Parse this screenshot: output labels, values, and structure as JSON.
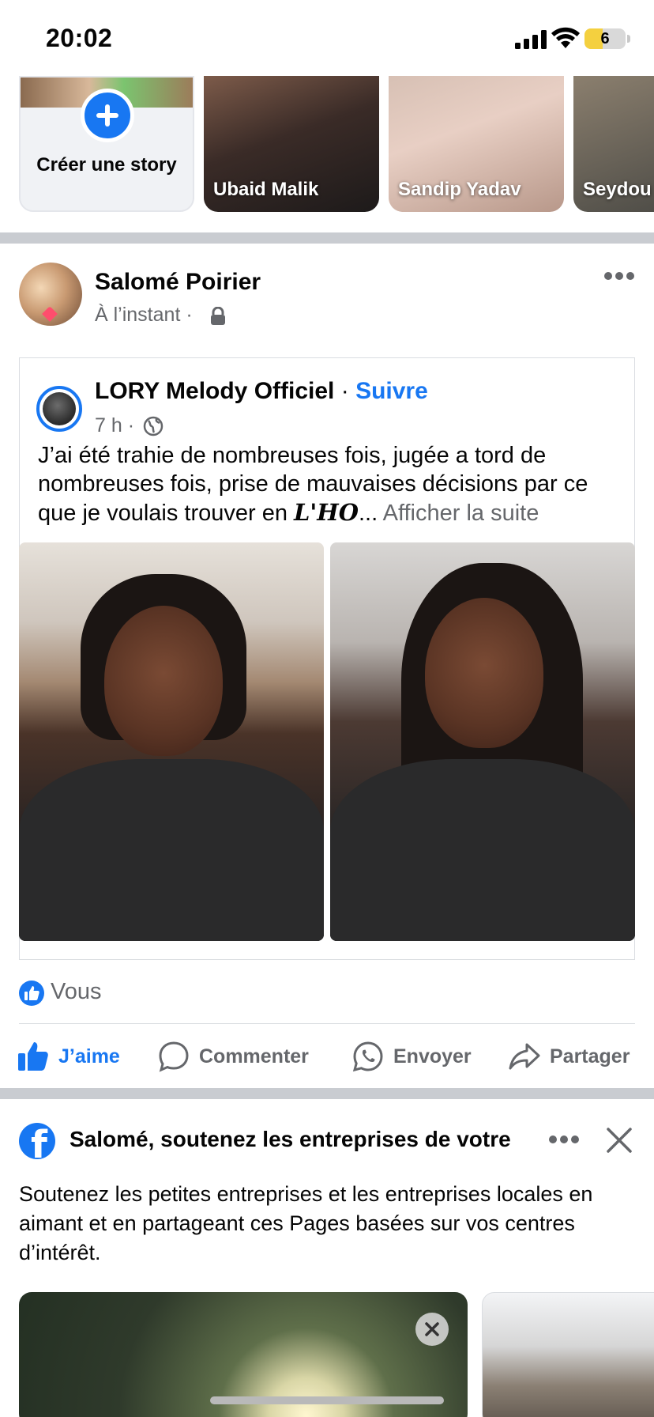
{
  "status_bar": {
    "time": "20:02",
    "battery_level": "6",
    "battery_fraction": 0.06,
    "icons": [
      "signal-icon",
      "wifi-icon",
      "battery-icon"
    ]
  },
  "stories": {
    "create_label": "Créer une story",
    "items": [
      {
        "name": "Ubaid Malik"
      },
      {
        "name": "Sandip Yadav"
      },
      {
        "name": "Seydou"
      }
    ]
  },
  "post": {
    "author": "Salomé Poirier",
    "time": "À l’instant ·",
    "privacy_icon": "lock-icon",
    "shared": {
      "author": "LORY Melody Officiel",
      "separator": " · ",
      "follow_label": "Suivre",
      "time": "7 h ·",
      "text": "J’ai été trahie de nombreuses fois, jugée a tord de nombreuses fois, prise de mauvaises décisions par ce que je voulais trouver en ",
      "text_italic": "L'HO",
      "ellipsis": "...",
      "see_more": "Afficher la suite"
    },
    "reactions": "Vous",
    "actions": {
      "like": "J’aime",
      "comment": "Commenter",
      "send": "Envoyer",
      "share": "Partager"
    }
  },
  "suggestion": {
    "title": "Salomé, soutenez les entreprises de votre",
    "description": "Soutenez les petites entreprises et les entreprises locales en aimant et en partageant ces Pages basées sur vos centres d’intérêt."
  },
  "colors": {
    "accent": "#1877f2",
    "secondary_text": "#65676b",
    "divider": "#c9ccd1"
  }
}
